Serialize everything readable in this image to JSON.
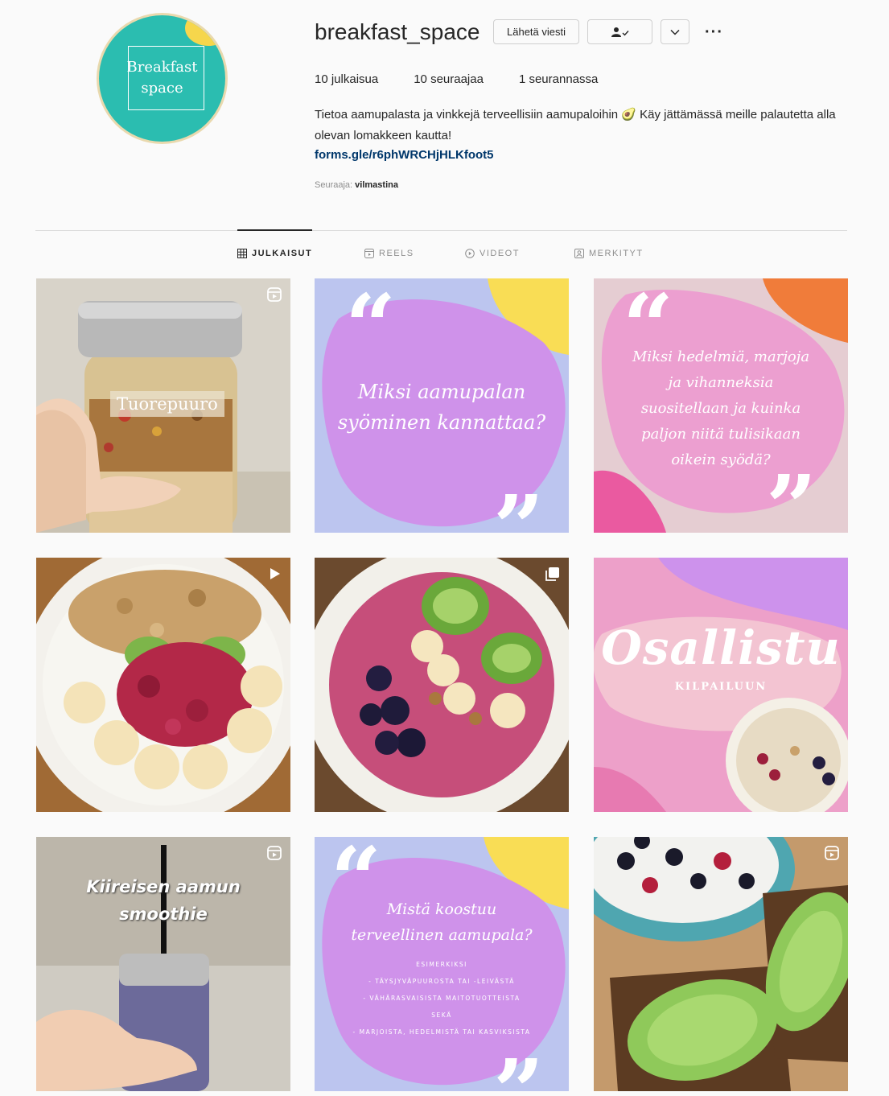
{
  "profile": {
    "avatar_line1": "Breakfast",
    "avatar_line2": "space",
    "username": "breakfast_space",
    "message_button": "Lähetä viesti",
    "more_icon": "ellipsis-icon"
  },
  "stats": {
    "posts": "10 julkaisua",
    "followers": "10 seuraajaa",
    "following": "1 seurannassa"
  },
  "bio": {
    "text": "Tietoa aamupalasta ja vinkkejä terveellisiin aamupaloihin 🥑 Käy jättämässä meille palautetta alla olevan lomakkeen kautta!",
    "link": "forms.gle/r6phWRCHjHLKfoot5",
    "followed_by_label": "Seuraaja:",
    "followed_by_user": "vilmastina"
  },
  "tabs": {
    "posts": "JULKAISUT",
    "reels": "REELS",
    "videos": "VIDEOT",
    "tagged": "MERKITYT"
  },
  "posts": {
    "p1": "Tuorepuuro",
    "p2_line1": "Miksi aamupalan",
    "p2_line2": "syöminen kannattaa?",
    "p3_line1": "Miksi hedelmiä, marjoja",
    "p3_line2": "ja vihanneksia",
    "p3_line3": "suositellaan ja kuinka",
    "p3_line4": "paljon niitä tulisikaan",
    "p3_line5": "oikein syödä?",
    "p6_title": "Osallistu",
    "p6_sub": "KILPAILUUN",
    "p7_line1": "Kiireisen aamun",
    "p7_line2": "smoothie",
    "p8_line1": "Mistä koostuu",
    "p8_line2": "terveellinen aamupala?",
    "p8_l1": "ESIMERKIKSI",
    "p8_l2": "- TÄYSJYVÄPUUROSTA TAI -LEIVÄSTÄ",
    "p8_l3": "- VÄHÄRASVAISISTA MAITOTUOTTEISTA",
    "p8_l4": "SEKÄ",
    "p8_l5": "- MARJOISTA, HEDELMISTÄ TAI KASVIKSISTA"
  },
  "colors": {
    "teal": "#2bbdb0",
    "purple": "#c98ee8",
    "pink": "#ef9fc9",
    "link": "#00376b"
  }
}
